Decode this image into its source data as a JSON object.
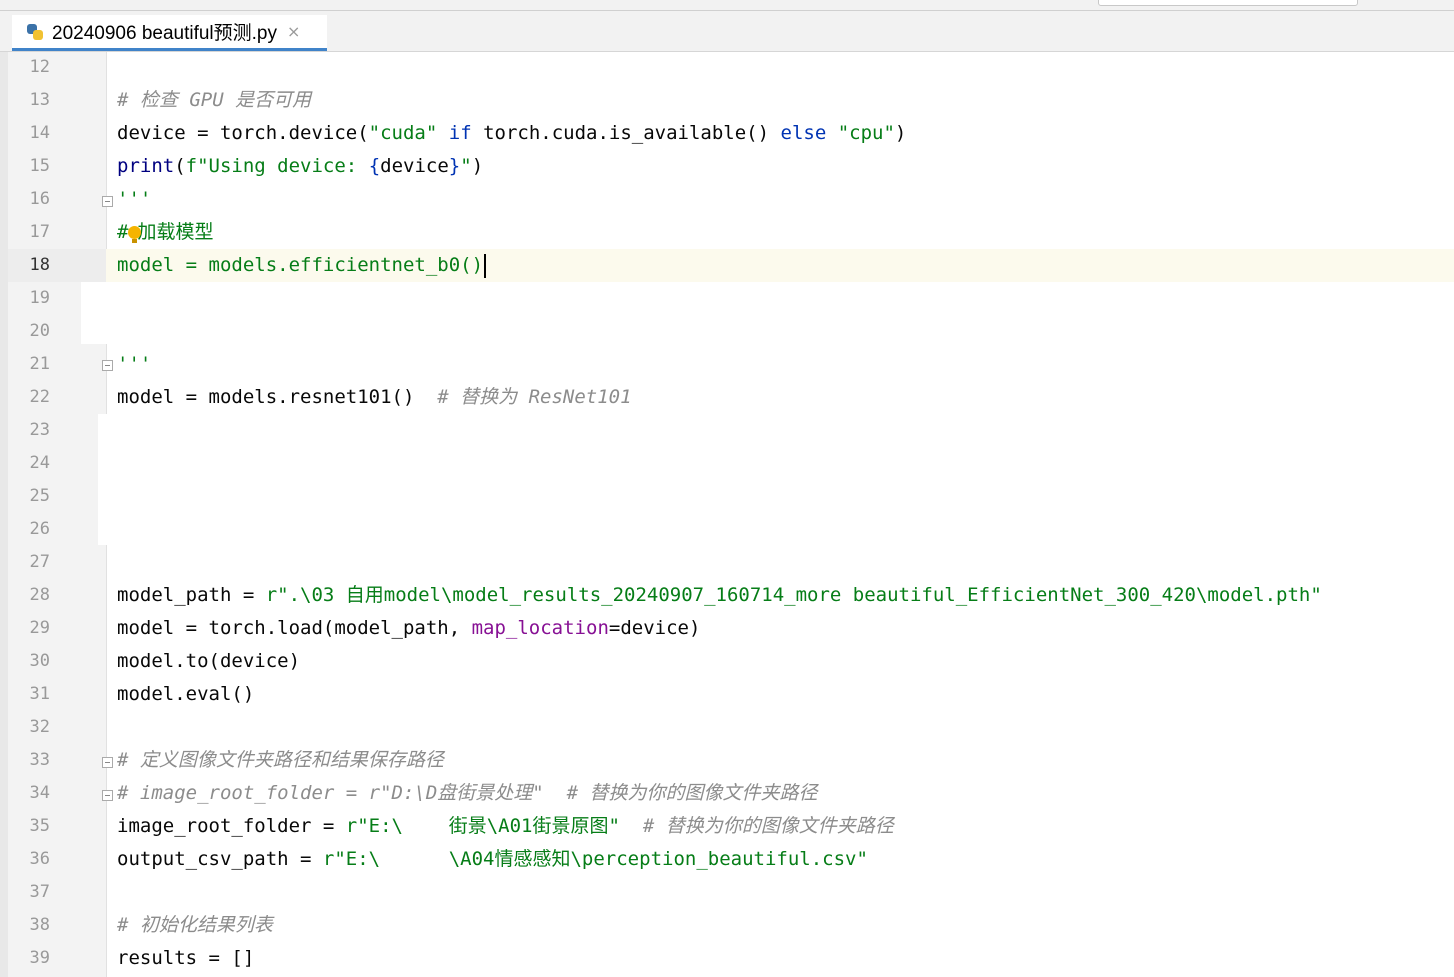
{
  "tab": {
    "title": "20240906 beautiful预测.py",
    "close": "×"
  },
  "lines": [
    {
      "n": "12"
    },
    {
      "n": "13"
    },
    {
      "n": "14"
    },
    {
      "n": "15"
    },
    {
      "n": "16"
    },
    {
      "n": "17"
    },
    {
      "n": "18"
    },
    {
      "n": "19"
    },
    {
      "n": "20"
    },
    {
      "n": "21"
    },
    {
      "n": "22"
    },
    {
      "n": "23"
    },
    {
      "n": "24"
    },
    {
      "n": "25"
    },
    {
      "n": "26"
    },
    {
      "n": "27"
    },
    {
      "n": "28"
    },
    {
      "n": "29"
    },
    {
      "n": "30"
    },
    {
      "n": "31"
    },
    {
      "n": "32"
    },
    {
      "n": "33"
    },
    {
      "n": "34"
    },
    {
      "n": "35"
    },
    {
      "n": "36"
    },
    {
      "n": "37"
    },
    {
      "n": "38"
    },
    {
      "n": "39"
    }
  ],
  "code": {
    "l13": "# 检查 GPU 是否可用",
    "l14a": "device = torch.device(",
    "l14b": "\"cuda\"",
    "l14c": " if ",
    "l14d": "torch.cuda.is_available() ",
    "l14e": "else",
    "l14f": " ",
    "l14g": "\"cpu\"",
    "l14h": ")",
    "l15a": "print",
    "l15b": "(",
    "l15c": "f\"Using device: ",
    "l15d": "{",
    "l15e": "device",
    "l15f": "}",
    "l15g": "\"",
    "l15h": ")",
    "l16": "'''",
    "l17a": "#",
    "l17b": "加载模型",
    "l18": "model = models.efficientnet_b0()",
    "l21": "'''",
    "l22a": "model = models.resnet101()  ",
    "l22b": "# 替换为 ResNet101",
    "l28a": "model_path = ",
    "l28b": "r\".\\03 自用model\\model_results_20240907_160714_more beautiful_EfficientNet_300_420\\model.pth\"",
    "l29a": "model = torch.load(model_path, ",
    "l29b": "map_location",
    "l29c": "=device)",
    "l30": "model.to(device)",
    "l31": "model.eval()",
    "l33": "# 定义图像文件夹路径和结果保存路径",
    "l34": "# image_root_folder = r\"D:\\D盘街景处理\"  # 替换为你的图像文件夹路径",
    "l35a": "image_root_folder = ",
    "l35b": "r\"E:\\    街景\\A01街景原图\"",
    "l35c": "  # 替换为你的图像文件夹路径",
    "l36a": "output_csv_path = ",
    "l36b": "r\"E:\\      \\A04情感感知\\perception_beautiful.csv\"",
    "l38": "# 初始化结果列表",
    "l39": "results = []"
  }
}
